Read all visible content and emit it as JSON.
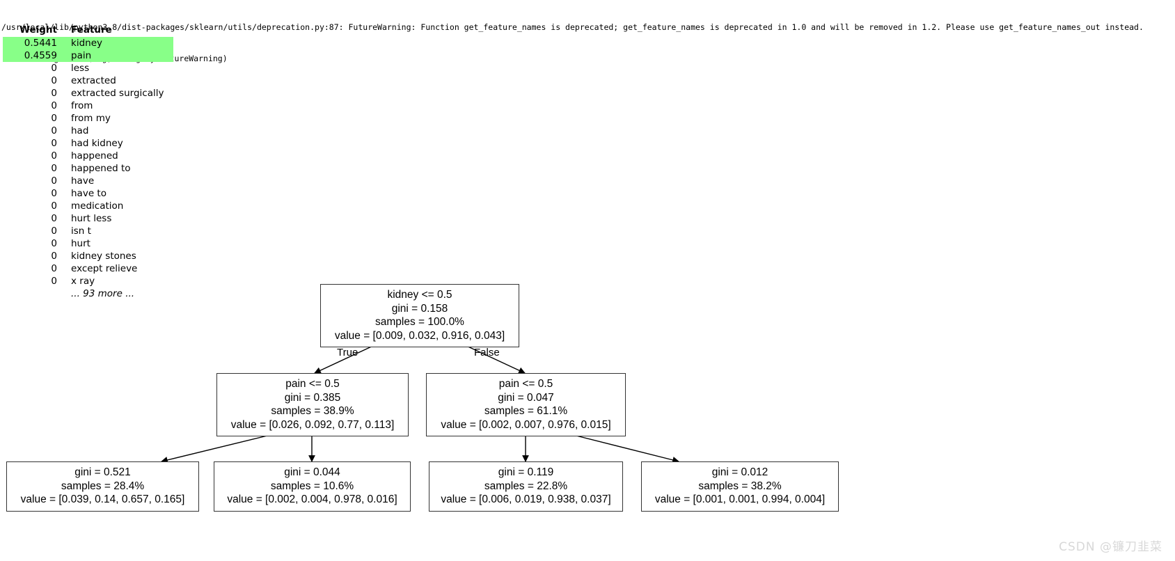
{
  "warning": {
    "line1": "/usr/local/lib/python3.8/dist-packages/sklearn/utils/deprecation.py:87: FutureWarning: Function get_feature_names is deprecated; get_feature_names is deprecated in 1.0 and will be removed in 1.2. Please use get_feature_names_out instead.",
    "line2": "  warnings.warn(msg, category=FutureWarning)"
  },
  "weights_table": {
    "headers": {
      "weight": "Weight",
      "feature": "Feature"
    },
    "highlight_color": "#88ff88",
    "rows": [
      {
        "weight": "0.5441",
        "feature": "kidney",
        "highlight": true
      },
      {
        "weight": "0.4559",
        "feature": "pain",
        "highlight": true
      },
      {
        "weight": "0",
        "feature": "less",
        "highlight": false
      },
      {
        "weight": "0",
        "feature": "extracted",
        "highlight": false
      },
      {
        "weight": "0",
        "feature": "extracted surgically",
        "highlight": false
      },
      {
        "weight": "0",
        "feature": "from",
        "highlight": false
      },
      {
        "weight": "0",
        "feature": "from my",
        "highlight": false
      },
      {
        "weight": "0",
        "feature": "had",
        "highlight": false
      },
      {
        "weight": "0",
        "feature": "had kidney",
        "highlight": false
      },
      {
        "weight": "0",
        "feature": "happened",
        "highlight": false
      },
      {
        "weight": "0",
        "feature": "happened to",
        "highlight": false
      },
      {
        "weight": "0",
        "feature": "have",
        "highlight": false
      },
      {
        "weight": "0",
        "feature": "have to",
        "highlight": false
      },
      {
        "weight": "0",
        "feature": "medication",
        "highlight": false
      },
      {
        "weight": "0",
        "feature": "hurt less",
        "highlight": false
      },
      {
        "weight": "0",
        "feature": "isn t",
        "highlight": false
      },
      {
        "weight": "0",
        "feature": "hurt",
        "highlight": false
      },
      {
        "weight": "0",
        "feature": "kidney stones",
        "highlight": false
      },
      {
        "weight": "0",
        "feature": "except relieve",
        "highlight": false
      },
      {
        "weight": "0",
        "feature": "x ray",
        "highlight": false
      }
    ],
    "more_row": "... 93 more ..."
  },
  "tree": {
    "edge_labels": {
      "true": "True",
      "false": "False"
    },
    "nodes": {
      "root": {
        "line1": "kidney <= 0.5",
        "line2": "gini = 0.158",
        "line3": "samples = 100.0%",
        "line4": "value = [0.009, 0.032, 0.916, 0.043]"
      },
      "left": {
        "line1": "pain <= 0.5",
        "line2": "gini = 0.385",
        "line3": "samples = 38.9%",
        "line4": "value = [0.026, 0.092, 0.77, 0.113]"
      },
      "right": {
        "line1": "pain <= 0.5",
        "line2": "gini = 0.047",
        "line3": "samples = 61.1%",
        "line4": "value = [0.002, 0.007, 0.976, 0.015]"
      },
      "leaf1": {
        "line1": "gini = 0.521",
        "line2": "samples = 28.4%",
        "line3": "value = [0.039, 0.14, 0.657, 0.165]"
      },
      "leaf2": {
        "line1": "gini = 0.044",
        "line2": "samples = 10.6%",
        "line3": "value = [0.002, 0.004, 0.978, 0.016]"
      },
      "leaf3": {
        "line1": "gini = 0.119",
        "line2": "samples = 22.8%",
        "line3": "value = [0.006, 0.019, 0.938, 0.037]"
      },
      "leaf4": {
        "line1": "gini = 0.012",
        "line2": "samples = 38.2%",
        "line3": "value = [0.001, 0.001, 0.994, 0.004]"
      }
    }
  },
  "watermark": "CSDN @镰刀韭菜"
}
